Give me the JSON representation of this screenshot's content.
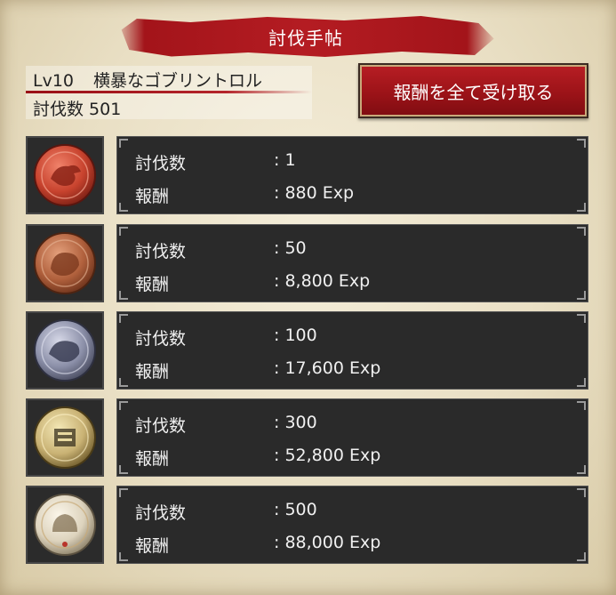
{
  "header": {
    "title": "討伐手帖"
  },
  "monster": {
    "level": "Lv10",
    "name": "横暴なゴブリントロル",
    "kill_count_text": "討伐数 501"
  },
  "claim_all_label": "報酬を全て受け取る",
  "labels": {
    "kills": "討伐数",
    "reward": "報酬"
  },
  "rows": [
    {
      "kills": ": 1",
      "reward": ": 880 Exp",
      "medal": "red-beast-medal-icon",
      "color": "#c8432e"
    },
    {
      "kills": ": 50",
      "reward": ": 8,800 Exp",
      "medal": "bronze-beast-medal-icon",
      "color": "#b0603c"
    },
    {
      "kills": ": 100",
      "reward": ": 17,600 Exp",
      "medal": "silver-beast-medal-icon",
      "color": "#8b8fa8"
    },
    {
      "kills": ": 300",
      "reward": ": 52,800 Exp",
      "medal": "gold-crest-medal-icon",
      "color": "#c9b274"
    },
    {
      "kills": ": 500",
      "reward": ": 88,000 Exp",
      "medal": "pearl-crest-medal-icon",
      "color": "#ddd3bd"
    }
  ]
}
